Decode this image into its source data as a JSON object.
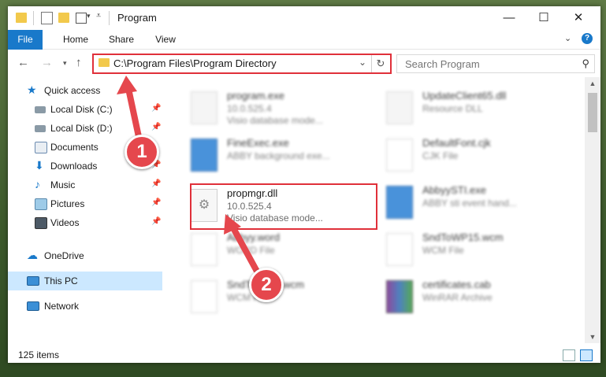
{
  "window": {
    "title": "Program",
    "controls": {
      "minimize": "—",
      "maximize": "☐",
      "close": "✕"
    }
  },
  "ribbon": {
    "tabs": [
      {
        "label": "File"
      },
      {
        "label": "Home"
      },
      {
        "label": "Share"
      },
      {
        "label": "View"
      }
    ]
  },
  "address": {
    "path": "C:\\Program Files\\Program Directory",
    "search_placeholder": "Search Program"
  },
  "navpane": {
    "items": [
      {
        "label": "Quick access",
        "icon": "star-icon"
      },
      {
        "label": "Local Disk (C:)",
        "icon": "drive-icon"
      },
      {
        "label": "Local Disk (D:)",
        "icon": "drive-icon"
      },
      {
        "label": "Documents",
        "icon": "documents-icon"
      },
      {
        "label": "Downloads",
        "icon": "download-icon"
      },
      {
        "label": "Music",
        "icon": "music-icon"
      },
      {
        "label": "Pictures",
        "icon": "pictures-icon"
      },
      {
        "label": "Videos",
        "icon": "videos-icon"
      },
      {
        "label": "OneDrive",
        "icon": "cloud-icon"
      },
      {
        "label": "This PC",
        "icon": "computer-icon",
        "selected": true
      },
      {
        "label": "Network",
        "icon": "network-icon"
      }
    ]
  },
  "files": [
    {
      "name": "program.exe",
      "line1": "10.0.525.4",
      "line2": "Visio database mode..."
    },
    {
      "name": "UpdateClient65.dll",
      "line1": "Resource DLL",
      "line2": ""
    },
    {
      "name": "FineExec.exe",
      "line1": "ABBY background exe...",
      "line2": ""
    },
    {
      "name": "DefaultFont.cjk",
      "line1": "CJK File",
      "line2": ""
    },
    {
      "name": "propmgr.dll",
      "line1": "10.0.525.4",
      "line2": "Visio database mode..."
    },
    {
      "name": "AbbyySTI.exe",
      "line1": "ABBY sti event hand...",
      "line2": ""
    },
    {
      "name": "Abbyy.word",
      "line1": "WORD File",
      "line2": ""
    },
    {
      "name": "SndToWP15.wcm",
      "line1": "WCM File",
      "line2": ""
    },
    {
      "name": "SndToWord.wcm",
      "line1": "WCM File",
      "line2": ""
    },
    {
      "name": "certificates.cab",
      "line1": "WinRAR Archive",
      "line2": ""
    }
  ],
  "status": {
    "count": "125 items"
  },
  "annotations": {
    "step1": "1",
    "step2": "2",
    "color": "#e5474d"
  }
}
